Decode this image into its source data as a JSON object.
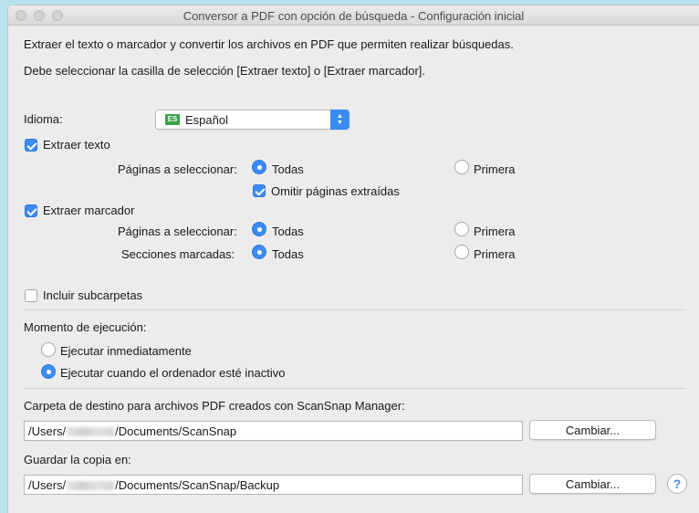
{
  "window": {
    "title": "Conversor a PDF con opción de búsqueda - Configuración inicial"
  },
  "intro": {
    "line1": "Extraer el texto o marcador y convertir los archivos en PDF que permiten realizar búsquedas.",
    "line2": "Debe seleccionar la casilla de selección [Extraer texto] o [Extraer marcador]."
  },
  "language": {
    "label": "Idioma:",
    "flag_text": "ES",
    "selected": "Español"
  },
  "extract_text": {
    "label": "Extraer texto",
    "checked": true,
    "pages_label": "Páginas a seleccionar:",
    "option_all": "Todas",
    "option_first": "Primera",
    "selected": "Todas",
    "omit_label": "Omitir páginas extraídas",
    "omit_checked": true
  },
  "extract_bookmark": {
    "label": "Extraer marcador",
    "checked": true,
    "pages_label": "Páginas a seleccionar:",
    "pages_all": "Todas",
    "pages_first": "Primera",
    "pages_selected": "Todas",
    "sections_label": "Secciones marcadas:",
    "sections_all": "Todas",
    "sections_first": "Primera",
    "sections_selected": "Todas"
  },
  "include_subfolders": {
    "label": "Incluir subcarpetas",
    "checked": false
  },
  "timing": {
    "label": "Momento de ejecución:",
    "option_now": "Ejecutar inmediatamente",
    "option_idle": "Ejecutar cuando el ordenador esté inactivo",
    "selected": "Ejecutar cuando el ordenador esté inactivo"
  },
  "destination": {
    "label": "Carpeta de destino para archivos PDF creados con ScanSnap Manager:",
    "path_prefix": "/Users/",
    "path_suffix": "/Documents/ScanSnap",
    "button": "Cambiar..."
  },
  "backup": {
    "label": "Guardar la copia en:",
    "path_prefix": "/Users/",
    "path_suffix": "/Documents/ScanSnap/Backup",
    "button": "Cambiar..."
  },
  "help": {
    "glyph": "?"
  },
  "colors": {
    "accent": "#3b8cf2",
    "window_bg": "#ececec",
    "desktop_bg": "#b7e3ec"
  }
}
